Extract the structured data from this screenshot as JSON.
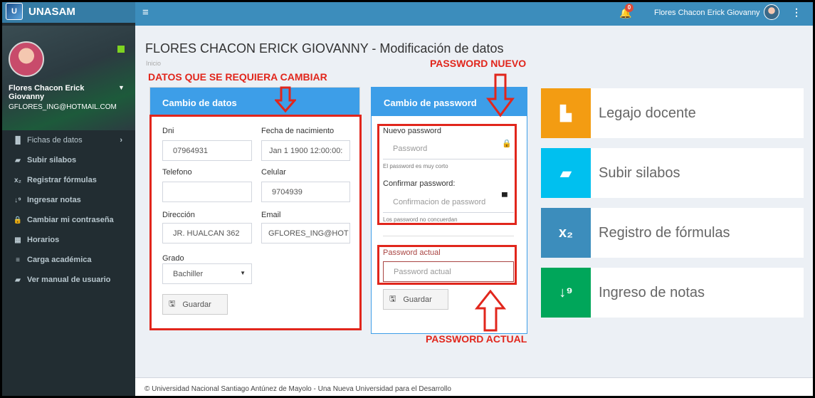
{
  "brand": {
    "name": "UNASAM"
  },
  "user": {
    "name": "Flores Chacon Erick Giovanny",
    "email": "GFLORES_ING@HOTMAIL.COM",
    "caret": "▼"
  },
  "sidebar": {
    "items": [
      {
        "icon": "bar-chart-icon",
        "glyph": "▐▌",
        "label": "Fichas de datos",
        "caret": "›"
      },
      {
        "icon": "book-icon",
        "glyph": "▰",
        "label": "Subir silabos"
      },
      {
        "icon": "subscript-icon",
        "glyph": "x₂",
        "label": "Registrar fórmulas"
      },
      {
        "icon": "sort-numeric-icon",
        "glyph": "↓⁹",
        "label": "Ingresar notas"
      },
      {
        "icon": "lock-icon",
        "glyph": "🔒",
        "label": "Cambiar mi contraseña"
      },
      {
        "icon": "calendar-icon",
        "glyph": "▦",
        "label": "Horarios"
      },
      {
        "icon": "list-icon",
        "glyph": "≡",
        "label": "Carga académica"
      },
      {
        "icon": "manual-book-icon",
        "glyph": "▰",
        "label": "Ver manual de usuario"
      }
    ]
  },
  "topbar": {
    "hamburger": "≡",
    "bell": "🔔",
    "notifications": "0",
    "user_name": "Flores Chacon Erick Giovanny",
    "kebab": "⋮"
  },
  "page": {
    "title": "FLORES CHACON ERICK GIOVANNY - Modificación de datos",
    "breadcrumb": "Inicio"
  },
  "annotations": {
    "datos": "DATOS QUE SE REQUIERA CAMBIAR",
    "password_nuevo": "PASSWORD NUEVO",
    "password_actual": "PASSWORD ACTUAL"
  },
  "datos_panel": {
    "title": "Cambio de datos",
    "dni": {
      "label": "Dni",
      "value": "07964931"
    },
    "fecha": {
      "label": "Fecha de nacimiento",
      "value": "Jan 1 1900 12:00:00:"
    },
    "telefono": {
      "label": "Telefono",
      "value": ""
    },
    "celular": {
      "label": "Celular",
      "value": "9704939"
    },
    "direccion": {
      "label": "Dirección",
      "value": "JR. HUALCAN 362"
    },
    "email": {
      "label": "Email",
      "value": "GFLORES_ING@HOT"
    },
    "grado": {
      "label": "Grado",
      "value": "Bachiller"
    },
    "save": "Guardar"
  },
  "password_panel": {
    "title": "Cambio de password",
    "nuevo": {
      "label": "Nuevo password",
      "placeholder": "Password",
      "help": "El password es muy corto"
    },
    "confirmar": {
      "label": "Confirmar password:",
      "placeholder": "Confirmacion de password",
      "help": "Los password no concuerdan"
    },
    "actual": {
      "label": "Password actual",
      "placeholder": "Password actual"
    },
    "save": "Guardar"
  },
  "tiles": [
    {
      "label": "Legajo docente",
      "icon": "file-icon",
      "glyph": "▙",
      "color": "#f39c12"
    },
    {
      "label": "Subir silabos",
      "icon": "book-icon",
      "glyph": "▰",
      "color": "#00c0ef"
    },
    {
      "label": "Registro de fórmulas",
      "icon": "subscript-icon",
      "glyph": "x₂",
      "color": "#3c8dbc"
    },
    {
      "label": "Ingreso de notas",
      "icon": "sort-numeric-icon",
      "glyph": "↓⁹",
      "color": "#00a65a"
    }
  ],
  "footer": {
    "text": "© Universidad Nacional Santiago Antúnez de Mayolo - Una Nueva Universidad para el Desarrollo"
  },
  "colors": {
    "annotation": "#e1261c",
    "panel_header": "#3d9ee8",
    "topbar": "#3c8dbc",
    "sidebar": "#222d32"
  }
}
